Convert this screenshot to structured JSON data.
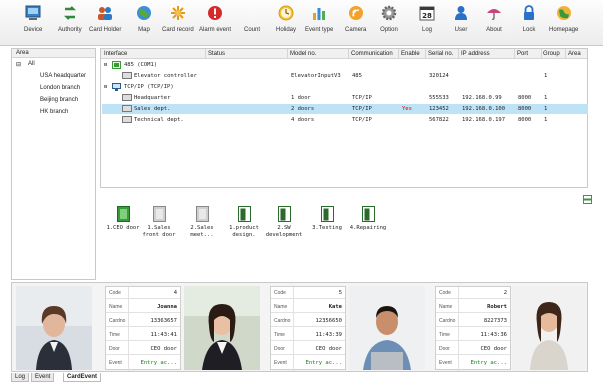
{
  "toolbar": {
    "buttons": [
      {
        "label": "Device",
        "icon": "device-icon"
      },
      {
        "label": "Authority",
        "icon": "authority-icon"
      },
      {
        "label": "Card Holder",
        "icon": "card-holder-icon"
      },
      {
        "label": "Map",
        "icon": "map-icon"
      },
      {
        "label": "Card record",
        "icon": "card-record-icon"
      },
      {
        "label": "Alarm event",
        "icon": "alarm-icon"
      },
      {
        "label": "Count",
        "icon": "count-icon"
      },
      {
        "label": "Holiday",
        "icon": "holiday-icon"
      },
      {
        "label": "Event type",
        "icon": "event-type-icon"
      },
      {
        "label": "Camera",
        "icon": "camera-icon"
      },
      {
        "label": "Option",
        "icon": "option-icon"
      },
      {
        "label": "Log",
        "icon": "log-icon",
        "badge": "28"
      },
      {
        "label": "User",
        "icon": "user-icon"
      },
      {
        "label": "About",
        "icon": "about-icon"
      },
      {
        "label": "Lock",
        "icon": "lock-icon"
      },
      {
        "label": "Homepage",
        "icon": "homepage-icon"
      }
    ]
  },
  "area_panel": {
    "header": "Area",
    "root": "All",
    "toggle": "⊟",
    "items": [
      "USA headquarter",
      "London branch",
      "Beijing branch",
      "HK branch"
    ]
  },
  "grid": {
    "columns": [
      "Interface",
      "Status",
      "Model no.",
      "Communication",
      "Enable",
      "Serial no.",
      "IP address",
      "Port",
      "Group",
      "Area"
    ],
    "groups": [
      {
        "label": "485 (COM1)",
        "toggle": "⊟"
      },
      {
        "label": "TCP/IP (TCP/IP)",
        "toggle": "⊟"
      }
    ],
    "rows": [
      {
        "interface": "Elevator controller",
        "model": "ElevatorInputV3",
        "comm": "485",
        "enable": "",
        "serial": "320124",
        "ip": "",
        "port": "",
        "group": "1"
      },
      {
        "interface": "Headquarter",
        "model": "1 door",
        "comm": "TCP/IP",
        "enable": "",
        "serial": "555533",
        "ip": "192.168.0.99",
        "port": "8000",
        "group": "1"
      },
      {
        "interface": "Sales dept.",
        "model": "2 doors",
        "comm": "TCP/IP",
        "enable": "Yes",
        "serial": "123452",
        "ip": "192.168.0.100",
        "port": "8000",
        "group": "1"
      },
      {
        "interface": "Technical dept.",
        "model": "4 doors",
        "comm": "TCP/IP",
        "enable": "",
        "serial": "567822",
        "ip": "192.168.0.197",
        "port": "8000",
        "group": "1"
      }
    ]
  },
  "doors": [
    {
      "label": "1.CEO door",
      "state": "open"
    },
    {
      "label": "1.Sales\nfront door",
      "state": "closed"
    },
    {
      "label": "2.Sales\nmeet...",
      "state": "closed"
    },
    {
      "label": "1.product\ndesign.",
      "state": "locked"
    },
    {
      "label": "2.SW\ndevelopment",
      "state": "locked"
    },
    {
      "label": "3.Testing",
      "state": "locked"
    },
    {
      "label": "4.Repairing",
      "state": "locked"
    }
  ],
  "card_events": [
    {
      "code": "4",
      "name": "Joanna",
      "cardno": "13363657",
      "time": "11:43:41",
      "door": "CEO door",
      "event": "Entry ac..."
    },
    {
      "code": "5",
      "name": "Kate",
      "cardno": "12356650",
      "time": "11:43:39",
      "door": "CEO door",
      "event": "Entry ac..."
    },
    {
      "code": "2",
      "name": "Robert",
      "cardno": "8227373",
      "time": "11:43:36",
      "door": "CEO door",
      "event": "Entry ac..."
    }
  ],
  "card_field_labels": {
    "code": "Code",
    "name": "Name",
    "cardno": "Cardno",
    "time": "Time",
    "door": "Door",
    "event": "Event"
  },
  "tabs": [
    "Log",
    "Event",
    "CardEvent"
  ],
  "colors": {
    "selected_row": "#bfe3f6",
    "enable_yes": "#d60000",
    "event_text": "#1a7a1a"
  }
}
